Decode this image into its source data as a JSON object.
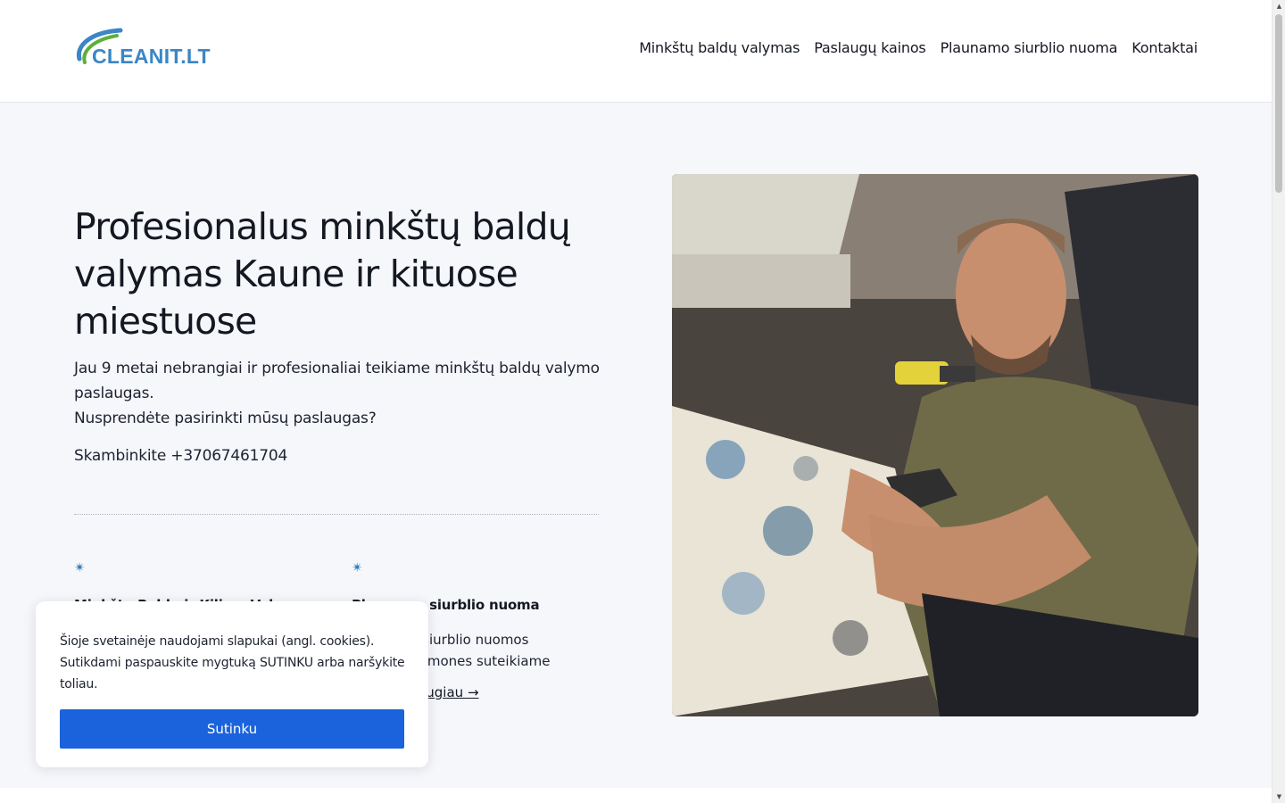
{
  "brand": {
    "logo_text": "CLEANIT.LT"
  },
  "nav": {
    "items": [
      {
        "label": "Minkštų baldų valymas"
      },
      {
        "label": "Paslaugų kainos"
      },
      {
        "label": "Plaunamo siurblio nuoma"
      },
      {
        "label": "Kontaktai"
      }
    ]
  },
  "hero": {
    "title": "Profesionalus minkštų baldų valymas Kaune ir kituose miestuose",
    "desc_line1": "Jau 9 metai nebrangiai ir profesionaliai teikiame minkštų baldų valymo paslaugas.",
    "desc_line2": "Nusprendėte pasirinkti mūsų paslaugas?",
    "call": "Skambinkite +37067461704"
  },
  "features": [
    {
      "icon": "star-icon",
      "title": "Minkštų Baldų ir Kilimų Valymas",
      "text": "",
      "link": ""
    },
    {
      "icon": "star-icon",
      "title": "Plaunamo siurblio nuoma",
      "text": "Plaunamo siurblio nuomos paslaugas įmones suteikiame",
      "link": "Sužinoti daugiau →"
    }
  ],
  "cookie": {
    "text": "Šioje svetainėje naudojami slapukai (angl. cookies). Sutikdami paspauskite mygtuką SUTINKU arba naršykite toliau.",
    "button": "Sutinku"
  },
  "colors": {
    "accent_blue": "#1a63dc",
    "logo_blue": "#3a86c6",
    "logo_green": "#5fae3d",
    "hero_bg": "#f6f7fb"
  }
}
